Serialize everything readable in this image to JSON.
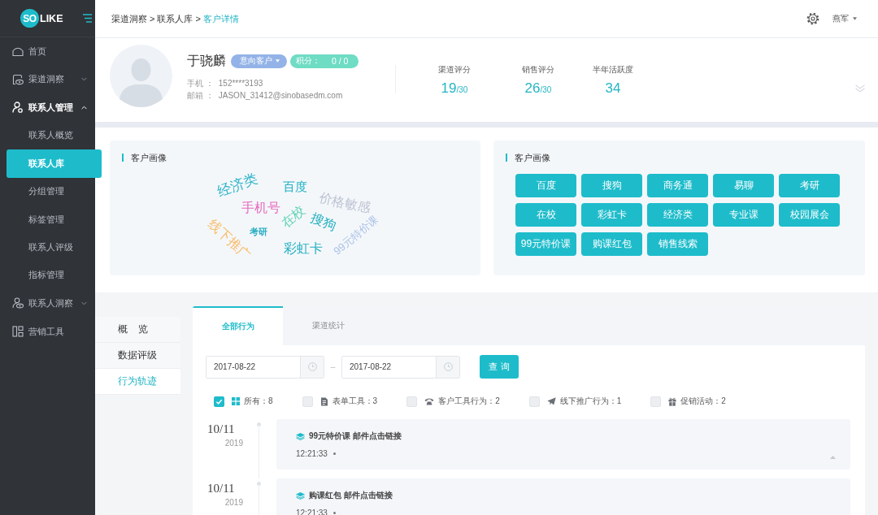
{
  "sidebar": {
    "logo": {
      "mark": "SO",
      "text": "LIKE"
    },
    "items": [
      {
        "label": "首页",
        "kind": "link",
        "selected": false
      },
      {
        "label": "渠道洞察",
        "kind": "group",
        "selected": false,
        "expanded": false
      },
      {
        "label": "联系人管理",
        "kind": "group",
        "selected": false,
        "expanded": true,
        "children": [
          {
            "label": "联系人概览",
            "selected": false
          },
          {
            "label": "联系人库",
            "selected": true
          },
          {
            "label": "分组管理",
            "selected": false
          },
          {
            "label": "标签管理",
            "selected": false
          },
          {
            "label": "联系人评级",
            "selected": false
          },
          {
            "label": "指标管理",
            "selected": false
          }
        ]
      },
      {
        "label": "联系人洞察",
        "kind": "group",
        "selected": false,
        "expanded": false
      },
      {
        "label": "营销工具",
        "kind": "link",
        "selected": false
      }
    ]
  },
  "topbar": {
    "breadcrumb": [
      {
        "label": "渠道洞察",
        "separator": ">",
        "current": false
      },
      {
        "label": "联系人库",
        "separator": ">",
        "current": false
      },
      {
        "label": "客户详情",
        "current": true
      }
    ],
    "user": "燕军"
  },
  "profile": {
    "name": "于骁麟",
    "status": "意向客户",
    "points": {
      "label": "积分：",
      "value": "0 / 0"
    },
    "contacts": [
      {
        "label": "手机 ：",
        "value": "152****3193"
      },
      {
        "label": "邮箱 ：",
        "value": "JASON_31412@sinobasedm.com"
      }
    ],
    "stats": [
      {
        "label": "渠道评分",
        "value": "19",
        "max": "/30"
      },
      {
        "label": "销售评分",
        "value": "26",
        "max": "/30"
      },
      {
        "label": "半年活跃度",
        "value": "34"
      }
    ]
  },
  "cloud_card": {
    "title": "客户画像",
    "words": [
      {
        "text": "经济类",
        "color": "#2bb3c9"
      },
      {
        "text": "百度",
        "color": "#1fb2c2"
      },
      {
        "text": "价格敏感",
        "color": "#bcc3d2"
      },
      {
        "text": "手机号",
        "color": "#e66bbd"
      },
      {
        "text": "在校",
        "color": "#62d3b4"
      },
      {
        "text": "搜狗",
        "color": "#1faebf"
      },
      {
        "text": "考研",
        "color": "#2aaec2"
      },
      {
        "text": "线下推广",
        "color": "#f8bb66"
      },
      {
        "text": "彩虹卡",
        "color": "#1fafc0"
      },
      {
        "text": "99元特价课",
        "color": "#a9c1e9"
      }
    ]
  },
  "tag_card": {
    "title": "客户画像",
    "tags": [
      "百度",
      "搜狗",
      "商务通",
      "易聊",
      "考研",
      "在校",
      "彩虹卡",
      "经济类",
      "专业课",
      "校园展会",
      "99元特价课",
      "购课红包",
      "销售线索"
    ]
  },
  "subnav": [
    {
      "label": "概    览",
      "selected": false
    },
    {
      "label": "数据评级",
      "selected": false
    },
    {
      "label": "行为轨迹",
      "selected": true
    }
  ],
  "activity": {
    "tabs": [
      {
        "label": "全部行为",
        "selected": true
      },
      {
        "label": "渠道统计",
        "selected": false
      }
    ],
    "date_from": "2017-08-22",
    "range_separator": "–",
    "date_to": "2017-08-22",
    "query_button": "查 询",
    "filters": [
      {
        "label": "所有：8",
        "checked": true
      },
      {
        "label": "表单工具：3",
        "checked": false
      },
      {
        "label": "客户工具行为：2",
        "checked": false
      },
      {
        "label": "线下推广行为：1",
        "checked": false
      },
      {
        "label": "促销活动：2",
        "checked": false
      }
    ],
    "timeline": [
      {
        "date": "10/11",
        "year": "2019",
        "title": "99元特价课 邮件点击链接",
        "time": "12:21:33"
      },
      {
        "date": "10/11",
        "year": "2019",
        "title": "购课红包 邮件点击链接",
        "time": "12:21:33"
      }
    ]
  }
}
